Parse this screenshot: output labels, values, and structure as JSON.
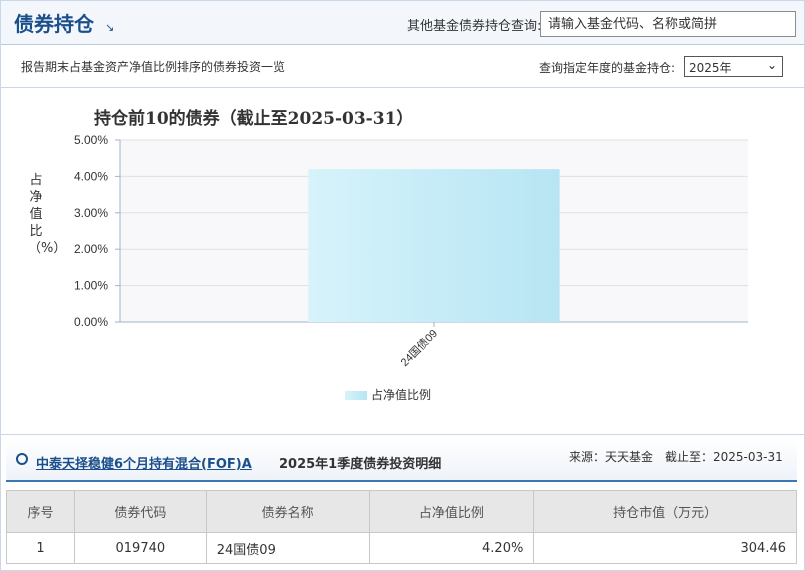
{
  "header": {
    "title": "债券持仓",
    "title_arrow": "↘",
    "query_label": "其他基金债券持仓查询:",
    "search_placeholder": "请输入基金代码、名称或简拼"
  },
  "subbar": {
    "description": "报告期末占基金资产净值比例排序的债券投资一览",
    "year_label": "查询指定年度的基金持仓:",
    "year_selected": "2025年"
  },
  "chart_data": {
    "type": "bar",
    "title": "持仓前10的债券（截止至2025-03-31）",
    "ylabel": "占净值比（%）",
    "categories": [
      "24国债09"
    ],
    "series": [
      {
        "name": "占净值比例",
        "values": [
          4.2
        ]
      }
    ],
    "ylim": [
      0,
      5
    ],
    "yticks": [
      "0.00%",
      "1.00%",
      "2.00%",
      "3.00%",
      "4.00%",
      "5.00%"
    ],
    "grid": true,
    "legend": "bottom",
    "colors": {
      "bar_start": "#d6f3fb",
      "bar_end": "#b7e5f3",
      "grid": "#e0e0e0",
      "axis": "#a0b4c8"
    }
  },
  "detail": {
    "fund_name": "中泰天择稳健6个月持有混合(FOF)A",
    "title": "2025年1季度债券投资明细",
    "source": "来源：天天基金　截止至：2025-03-31"
  },
  "table": {
    "headers": [
      "序号",
      "债券代码",
      "债券名称",
      "占净值比例",
      "持仓市值（万元）"
    ],
    "rows": [
      [
        "1",
        "019740",
        "24国债09",
        "4.20%",
        "304.46"
      ]
    ]
  },
  "colors": {
    "brand": "#1b4f8a",
    "accent_line": "#3b76b5"
  }
}
